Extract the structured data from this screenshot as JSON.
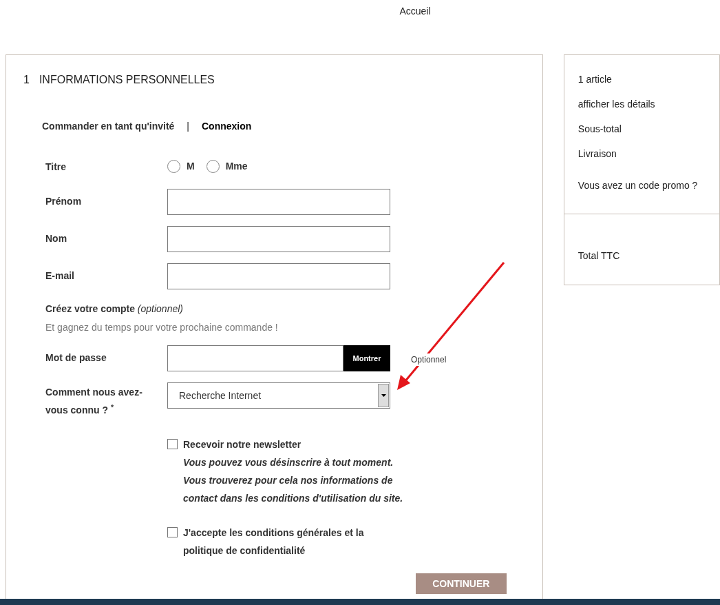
{
  "header": {
    "link": "Accueil"
  },
  "section": {
    "number": "1",
    "title": "INFORMATIONS PERSONNELLES"
  },
  "tabs": [
    {
      "label": "Commander en tant qu'invité",
      "selected": false
    },
    {
      "label": "Connexion",
      "selected": true
    }
  ],
  "tab_separator": "|",
  "title_field": {
    "label": "Titre",
    "options": [
      {
        "label": "M",
        "selected": false
      },
      {
        "label": "Mme",
        "selected": false
      }
    ]
  },
  "fields": [
    {
      "label": "Prénom"
    },
    {
      "label": "Nom"
    },
    {
      "label": "E-mail"
    }
  ],
  "account": {
    "heading": "Créez votre compte *(optionnel)*",
    "subtitle": "Et gagnez du temps pour votre prochaine commande !"
  },
  "password": {
    "label": "Mot de passe",
    "button": "Montrer",
    "hint": "Optionnel"
  },
  "source": {
    "label": "Comment nous avez-vous connu ? $^{*}$",
    "value": "Recherche Internet"
  },
  "checkboxes": [
    {
      "label": "Recevoir notre newsletter",
      "note": "Vous pouvez vous désinscrire à tout moment. Vous trouverez pour cela nos informations de contact dans les conditions d'utilisation du site.",
      "checked": false
    },
    {
      "label": "J'accepte les conditions générales et la politique de confidentialité",
      "checked": false
    }
  ],
  "continue_button": "CONTINUER",
  "summary": {
    "items": [
      "1 article",
      "afficher les détails",
      "Sous-total",
      "Livraison",
      "Vous avez un code promo ?"
    ],
    "total": "Total TTC"
  }
}
